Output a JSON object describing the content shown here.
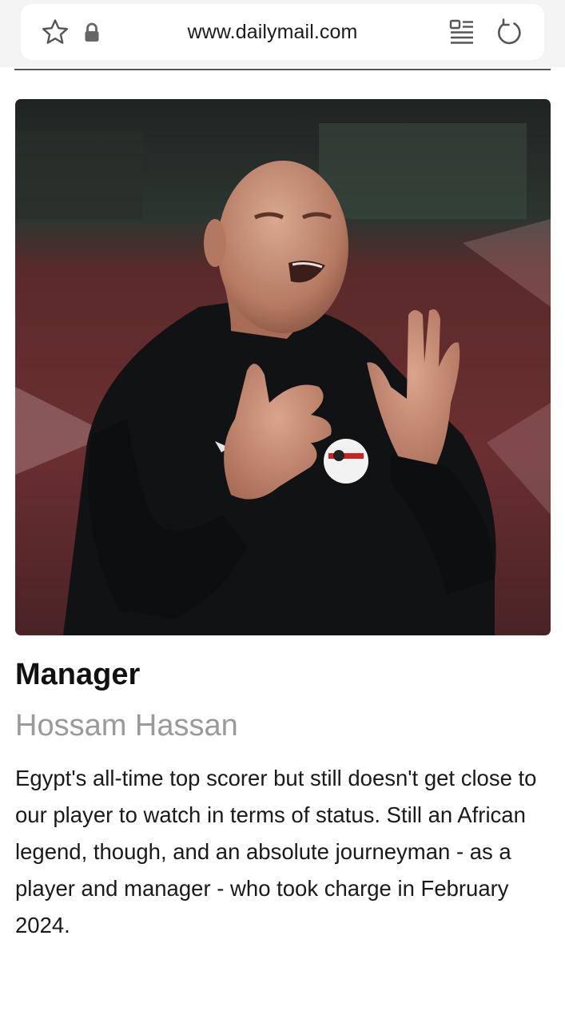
{
  "browser": {
    "url": "www.dailymail.com",
    "icons": {
      "bookmark": "star-icon",
      "security": "lock-icon",
      "reader": "reader-mode-icon",
      "reload": "reload-icon"
    }
  },
  "article": {
    "role": "Manager",
    "name": "Hossam Hassan",
    "description": "Egypt's all-time top scorer but still doesn't get close to our player to watch in terms of status. Still an African legend, though, and an absolute journeyman - as a player and manager - who took charge in February 2024."
  },
  "colors": {
    "background": "#ffffff",
    "topbar": "#f4f4f5",
    "heading": "#111111",
    "subheading": "#9a9a9a",
    "body": "#1a1a1a"
  }
}
